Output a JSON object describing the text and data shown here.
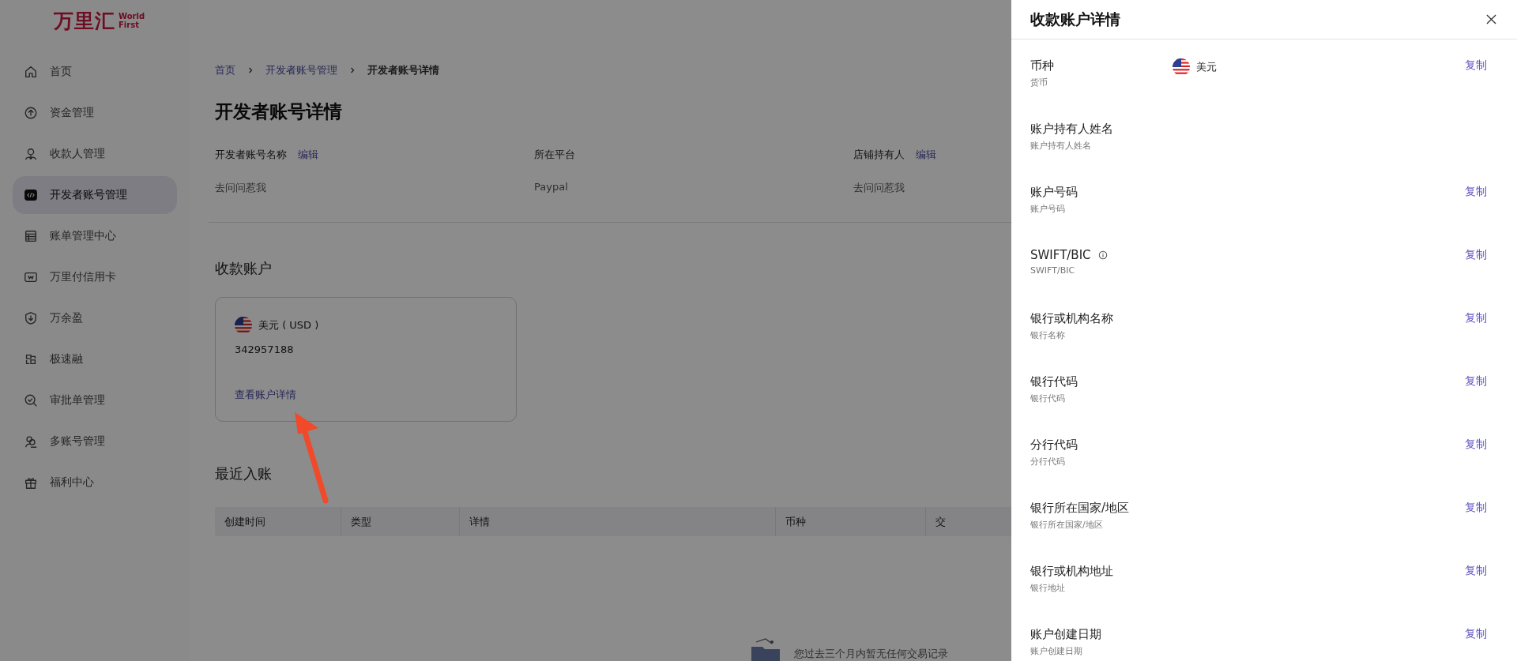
{
  "sidebar": {
    "logo": {
      "name": "万里汇",
      "tagline": [
        "World",
        "First"
      ]
    },
    "items": [
      {
        "label": "首页",
        "selected": false
      },
      {
        "label": "资金管理",
        "selected": false
      },
      {
        "label": "收款人管理",
        "selected": false
      },
      {
        "label": "开发者账号管理",
        "selected": true
      },
      {
        "label": "账单管理中心",
        "selected": false
      },
      {
        "label": "万里付信用卡",
        "selected": false
      },
      {
        "label": "万余盈",
        "selected": false
      },
      {
        "label": "极速融",
        "selected": false
      },
      {
        "label": "审批单管理",
        "selected": false
      },
      {
        "label": "多账号管理",
        "selected": false
      },
      {
        "label": "福利中心",
        "selected": false
      }
    ]
  },
  "breadcrumb": [
    "首页",
    "开发者账号管理",
    "开发者账号详情"
  ],
  "page_title": "开发者账号详情",
  "info_fields": [
    {
      "label": "开发者账号名称",
      "edit": "编辑",
      "value": "去问问惹我"
    },
    {
      "label": "所在平台",
      "value": "Paypal"
    },
    {
      "label": "店铺持有人",
      "edit": "编辑",
      "value": "去问问惹我"
    }
  ],
  "accounts_section": {
    "title": "收款账户",
    "card": {
      "currency": "美元 ( USD )",
      "number": "342957188",
      "link": "查看账户详情"
    }
  },
  "recent_section": {
    "title": "最近入账",
    "table": {
      "columns": [
        "创建时间",
        "类型",
        "详情",
        "币种",
        "交"
      ]
    },
    "empty_text": "您过去三个月内暂无任何交易记录"
  },
  "drawer": {
    "title": "收款账户详情",
    "rows": [
      {
        "label": "币种",
        "hint": "货币",
        "value": "美元",
        "copy": "复制"
      },
      {
        "label": "账户持有人姓名",
        "hint": "账户持有人姓名"
      },
      {
        "label": "账户号码",
        "hint": "账户号码",
        "copy": "复制"
      },
      {
        "label": "SWIFT/BIC",
        "hint": "SWIFT/BIC",
        "info": true,
        "copy": "复制"
      },
      {
        "label": "银行或机构名称",
        "hint": "银行名称",
        "copy": "复制"
      },
      {
        "label": "银行代码",
        "hint": "银行代码",
        "copy": "复制"
      },
      {
        "label": "分行代码",
        "hint": "分行代码",
        "copy": "复制"
      },
      {
        "label": "银行所在国家/地区",
        "hint": "银行所在国家/地区",
        "copy": "复制"
      },
      {
        "label": "银行或机构地址",
        "hint": "银行地址",
        "copy": "复制"
      },
      {
        "label": "账户创建日期",
        "hint": "账户创建日期",
        "copy": "复制"
      }
    ]
  }
}
